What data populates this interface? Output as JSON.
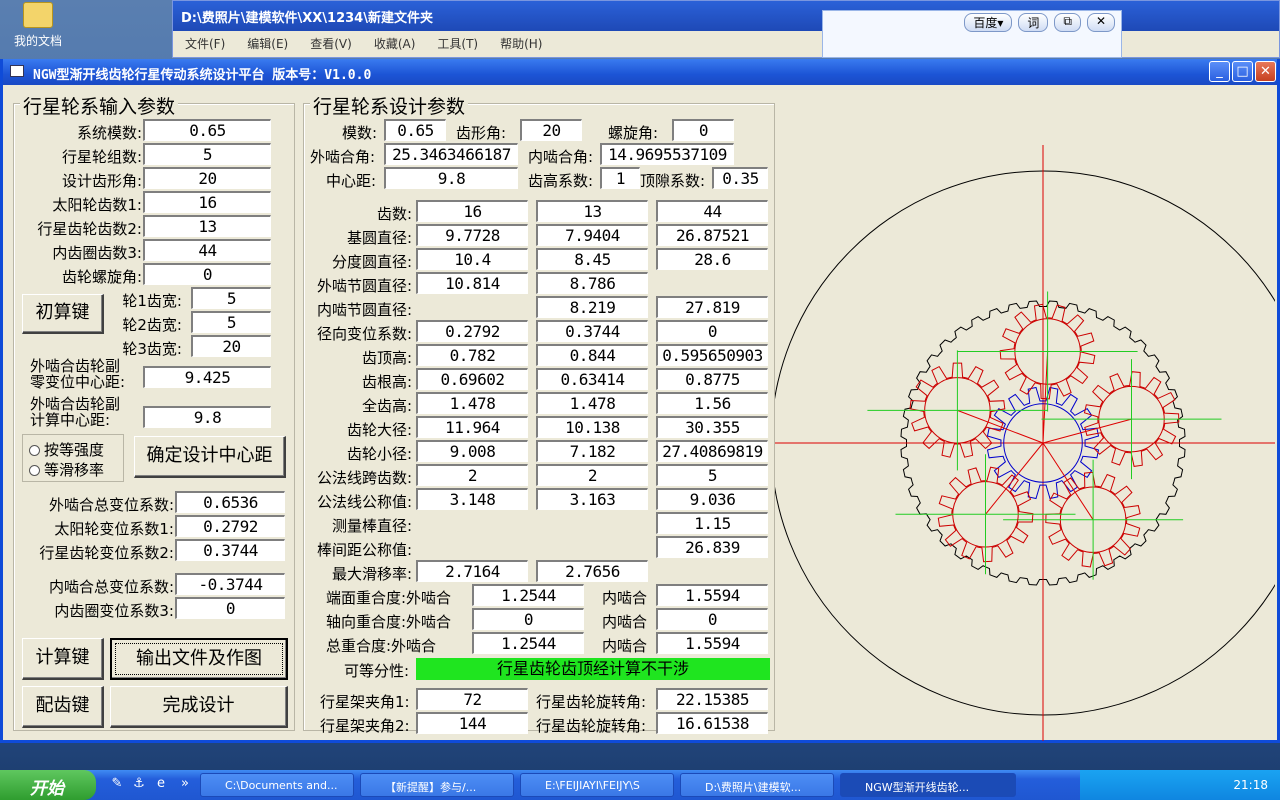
{
  "desktop": {
    "icon_label": "我的文档"
  },
  "bg_window": {
    "title": "D:\\费照片\\建模软件\\XX\\1234\\新建文件夹",
    "menu": [
      "文件(F)",
      "编辑(E)",
      "查看(V)",
      "收藏(A)",
      "工具(T)",
      "帮助(H)"
    ]
  },
  "baidu": {
    "search": "百度▾",
    "ci": "词",
    "copy": "⧉",
    "close": "✕"
  },
  "window": {
    "title": "NGW型渐开线齿轮行星传动系统设计平台   版本号：V1.0.0",
    "min": "_",
    "max": "□",
    "close": "✕"
  },
  "input_group": {
    "title": "行星轮系输入参数",
    "rows": [
      {
        "label": "系统模数:",
        "value": "0.65"
      },
      {
        "label": "行星轮组数:",
        "value": "5"
      },
      {
        "label": "设计齿形角:",
        "value": "20"
      },
      {
        "label": "太阳轮齿数1:",
        "value": "16"
      },
      {
        "label": "行星齿轮齿数2:",
        "value": "13"
      },
      {
        "label": "内齿圈齿数3:",
        "value": "44"
      },
      {
        "label": "齿轮螺旋角:",
        "value": "0"
      }
    ],
    "init_button": "初算键",
    "widths": [
      {
        "label": "轮1齿宽:",
        "value": "5"
      },
      {
        "label": "轮2齿宽:",
        "value": "5"
      },
      {
        "label": "轮3齿宽:",
        "value": "20"
      }
    ],
    "zero_center_label": "外啮合齿轮副\n零变位中心距:",
    "zero_center_value": "9.425",
    "calc_center_label": "外啮合齿轮副\n计算中心距:",
    "calc_center_value": "9.8",
    "radio1": "按等强度",
    "radio2": "等滑移率",
    "confirm_button": "确定设计中心距",
    "shift_rows": [
      {
        "label": "外啮合总变位系数:",
        "value": "0.6536"
      },
      {
        "label": "太阳轮变位系数1:",
        "value": "0.2792"
      },
      {
        "label": "行星齿轮变位系数2:",
        "value": "0.3744"
      }
    ],
    "int_shift_rows": [
      {
        "label": "内啮合总变位系数:",
        "value": "-0.3744"
      },
      {
        "label": "内齿圈变位系数3:",
        "value": "0"
      }
    ],
    "calc_button": "计算键",
    "output_button": "输出文件及作图",
    "match_button": "配齿键",
    "finish_button": "完成设计"
  },
  "design_group": {
    "title": "行星轮系设计参数",
    "module_label": "模数:",
    "module": "0.65",
    "tooth_angle_label": "齿形角:",
    "tooth_angle": "20",
    "helix_label": "螺旋角:",
    "helix": "0",
    "ext_angle_label": "外啮合角:",
    "ext_angle": "25.3463466187",
    "int_angle_label": "内啮合角:",
    "int_angle": "14.9695537109",
    "center_label": "中心距:",
    "center": "9.8",
    "addendum_coef_label": "齿高系数:",
    "addendum_coef": "1",
    "clearance_label": "顶隙系数:",
    "clearance": "0.35",
    "table": [
      {
        "label": "齿数:",
        "v": [
          "16",
          "13",
          "44"
        ]
      },
      {
        "label": "基圆直径:",
        "v": [
          "9.7728",
          "7.9404",
          "26.87521"
        ]
      },
      {
        "label": "分度圆直径:",
        "v": [
          "10.4",
          "8.45",
          "28.6"
        ]
      },
      {
        "label": "外啮节圆直径:",
        "v": [
          "10.814",
          "8.786",
          ""
        ]
      },
      {
        "label": "内啮节圆直径:",
        "v": [
          "",
          "8.219",
          "27.819"
        ]
      },
      {
        "label": "径向变位系数:",
        "v": [
          "0.2792",
          "0.3744",
          "0"
        ]
      },
      {
        "label": "齿顶高:",
        "v": [
          "0.782",
          "0.844",
          "0.595650903"
        ]
      },
      {
        "label": "齿根高:",
        "v": [
          "0.69602",
          "0.63414",
          "0.8775"
        ]
      },
      {
        "label": "全齿高:",
        "v": [
          "1.478",
          "1.478",
          "1.56"
        ]
      },
      {
        "label": "齿轮大径:",
        "v": [
          "11.964",
          "10.138",
          "30.355"
        ]
      },
      {
        "label": "齿轮小径:",
        "v": [
          "9.008",
          "7.182",
          "27.40869819"
        ]
      },
      {
        "label": "公法线跨齿数:",
        "v": [
          "2",
          "2",
          "5"
        ]
      },
      {
        "label": "公法线公称值:",
        "v": [
          "3.148",
          "3.163",
          "9.036"
        ]
      },
      {
        "label": "测量棒直径:",
        "v": [
          "",
          "",
          "1.15"
        ]
      },
      {
        "label": "棒间距公称值:",
        "v": [
          "",
          "",
          "26.839"
        ]
      },
      {
        "label": "最大滑移率:",
        "v": [
          "2.7164",
          "2.7656",
          ""
        ]
      }
    ],
    "contact_rows": [
      {
        "label": "端面重合度:外啮合",
        "ext": "1.2544",
        "int_label": "内啮合",
        "int": "1.5594"
      },
      {
        "label": "轴向重合度:外啮合",
        "ext": "0",
        "int_label": "内啮合",
        "int": "0"
      },
      {
        "label": "总重合度:外啮合",
        "ext": "1.2544",
        "int_label": "内啮合",
        "int": "1.5594"
      }
    ],
    "divisible_label": "可等分性:",
    "divisible_text": "行星齿轮齿顶经计算不干涉",
    "carrier_rows": [
      {
        "label": "行星架夹角1:",
        "value": "72",
        "rot_label": "行星齿轮旋转角:",
        "rot": "22.15385"
      },
      {
        "label": "行星架夹角2:",
        "value": "144",
        "rot_label": "行星齿轮旋转角:",
        "rot": "16.61538"
      }
    ]
  },
  "taskbar": {
    "start": "开始",
    "items": [
      "C:\\Documents and...",
      "【新提醒】参与/...",
      "E:\\FEIJIAYI\\FEIJY\\S",
      "D:\\费照片\\建模软...",
      "NGW型渐开线齿轮..."
    ],
    "clock": "21:18"
  },
  "colors": {
    "titlebar": "#1c54d5",
    "banner": "#1fe51f",
    "ring": "#000000",
    "planet": "#cc0000",
    "sun": "#0000cc",
    "axis_red": "#dd0000",
    "axis_green": "#22cc22"
  }
}
